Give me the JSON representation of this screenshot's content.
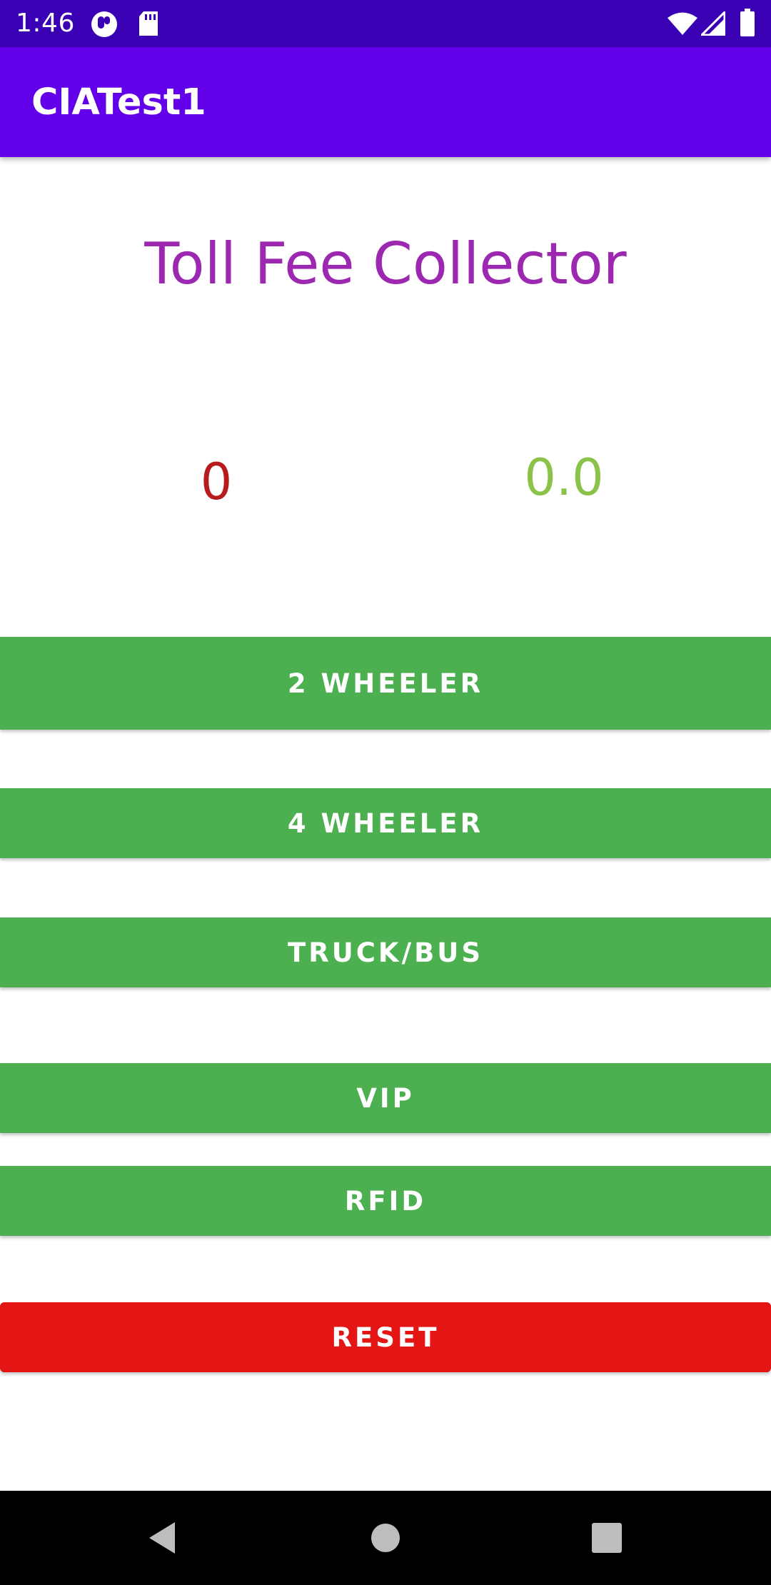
{
  "status_bar": {
    "time": "1:46",
    "icons": [
      "notification-icon",
      "sd-card-icon",
      "wifi-icon",
      "signal-icon",
      "battery-icon"
    ]
  },
  "app_bar": {
    "title": "CIATest1"
  },
  "main": {
    "heading": "Toll Fee Collector",
    "vehicle_count": "0",
    "total_amount": "0.0"
  },
  "buttons": {
    "two_wheeler": "2 WHEELER",
    "four_wheeler": "4 WHEELER",
    "truck_bus": "TRUCK/BUS",
    "vip": "VIP",
    "rfid": "RFID",
    "reset": "RESET"
  },
  "nav_bar": {
    "icons": [
      "back-icon",
      "home-icon",
      "recents-icon"
    ]
  },
  "colors": {
    "status_bar": "#3a00b3",
    "app_bar": "#6200ea",
    "heading": "#9c27b0",
    "count": "#b71c1c",
    "amount": "#8bc34a",
    "button_green": "#4caf50",
    "button_reset": "#e31515"
  }
}
